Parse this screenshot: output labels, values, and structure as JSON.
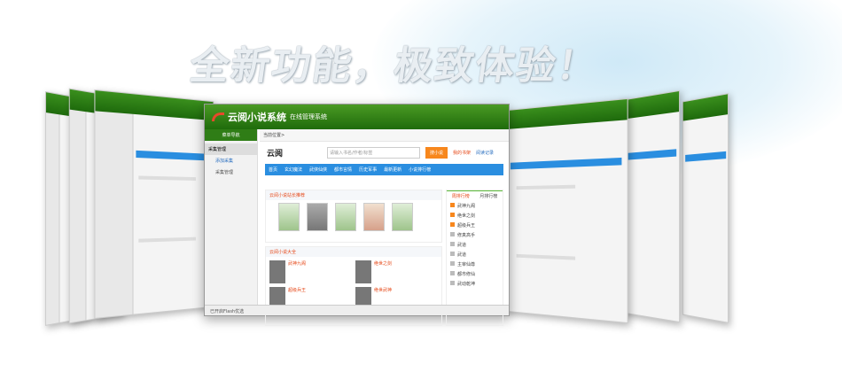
{
  "headline": "全新功能，极致体验！",
  "window": {
    "title": "云阅小说系统",
    "subtitle": "在线管理系统",
    "sidebar": {
      "header": "菜单导航",
      "group": "采集管理",
      "items": [
        "添加采集",
        "采集管理"
      ]
    },
    "breadcrumb": "当前位置>",
    "brand": "云阅",
    "search_placeholder": "请输入书名/作者/标签",
    "search_button": "搜小说",
    "bookshelf": "我的书架",
    "history": "阅读记录",
    "nav": [
      "首页",
      "玄幻魔法",
      "武侠仙侠",
      "都市言情",
      "历史军事",
      "最新更新",
      "小说排行榜"
    ],
    "recommend_title": "云阅小说站长推荐",
    "library_title": "云阅小说大全",
    "books": [
      "武神九阁",
      "绝世之剑",
      "超级兵王",
      "绝世武神"
    ],
    "rank_tabs": [
      "周排行榜",
      "月排行榜"
    ],
    "rank_items": [
      "武神九阁",
      "绝世之剑",
      "超级兵王",
      "修真高手",
      "武道",
      "武道",
      "主宰仙尊",
      "都市修仙",
      "武动乾坤"
    ],
    "footer": "已开启Flash优选"
  },
  "colors": {
    "header_green": "#2f7d16",
    "nav_blue": "#2a8ee0",
    "accent_orange": "#f7871d"
  }
}
